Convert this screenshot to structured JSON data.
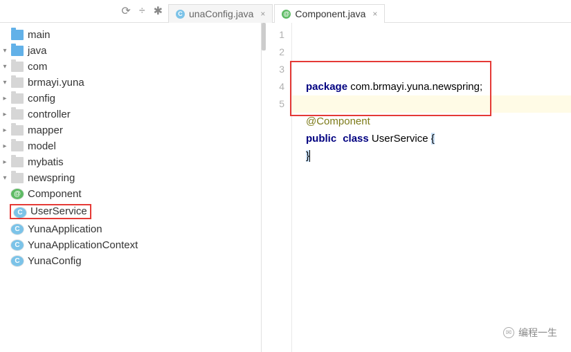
{
  "tabs": [
    {
      "label": "unaConfig.java",
      "iconClass": "circle-blue",
      "iconLetter": "C"
    },
    {
      "label": "Component.java",
      "iconClass": "circle-green",
      "iconLetter": "@"
    }
  ],
  "tree": {
    "items": [
      {
        "depth": 0,
        "expander": "",
        "icon": "folder-blue",
        "label": "main"
      },
      {
        "depth": 1,
        "expander": "down",
        "icon": "folder-blue",
        "label": "java"
      },
      {
        "depth": 2,
        "expander": "down",
        "icon": "folder",
        "label": "com"
      },
      {
        "depth": 3,
        "expander": "down",
        "icon": "folder",
        "label": "brmayi.yuna"
      },
      {
        "depth": 4,
        "expander": "right",
        "icon": "folder",
        "label": "config"
      },
      {
        "depth": 4,
        "expander": "right",
        "icon": "folder",
        "label": "controller"
      },
      {
        "depth": 4,
        "expander": "right",
        "icon": "folder",
        "label": "mapper"
      },
      {
        "depth": 4,
        "expander": "right",
        "icon": "folder",
        "label": "model"
      },
      {
        "depth": 4,
        "expander": "right",
        "icon": "folder",
        "label": "mybatis"
      },
      {
        "depth": 4,
        "expander": "down",
        "icon": "folder",
        "label": "newspring"
      },
      {
        "depth": 5,
        "expander": "",
        "icon": "circle-green",
        "iconLetter": "@",
        "label": "Component"
      },
      {
        "depth": 5,
        "expander": "",
        "icon": "circle-blue",
        "iconLetter": "C",
        "label": "UserService",
        "red": true
      },
      {
        "depth": 5,
        "expander": "",
        "icon": "circle-blue",
        "iconLetter": "C",
        "label": "YunaApplication"
      },
      {
        "depth": 5,
        "expander": "",
        "icon": "circle-blue",
        "iconLetter": "C",
        "label": "YunaApplicationContext"
      },
      {
        "depth": 5,
        "expander": "",
        "icon": "circle-blue",
        "iconLetter": "C",
        "label": "YunaConfig"
      }
    ]
  },
  "editor": {
    "lines": [
      "1",
      "2",
      "3",
      "4",
      "5"
    ],
    "code": {
      "package_kw": "package",
      "package_name": " com.brmayi.yuna.newspring;",
      "annotation": "@Component",
      "public_kw": "public",
      "class_kw": "class",
      "class_name": " UserService ",
      "brace_open": "{",
      "brace_close": "}"
    }
  },
  "watermark": {
    "text": "编程一生"
  }
}
